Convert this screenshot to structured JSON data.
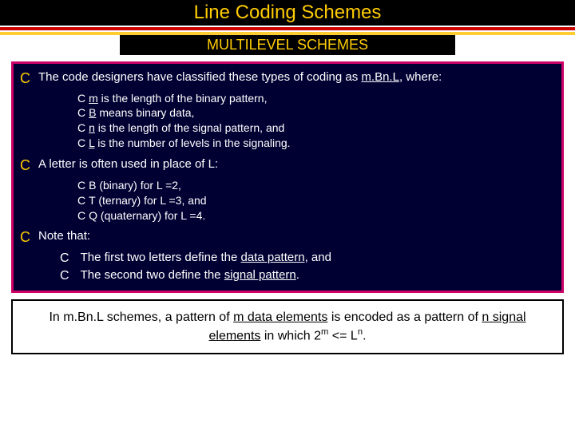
{
  "title": "Line Coding Schemes",
  "subtitle": "MULTILEVEL SCHEMES",
  "p1": {
    "prefix": "The code designers have classified these types of coding as ",
    "term": "m.Bn.L",
    "suffix": ", where:"
  },
  "p1_sub": {
    "a_pre": "m",
    "a_post": " is the length of the binary pattern,",
    "b_pre": "B",
    "b_post": " means binary data,",
    "c_pre": "n",
    "c_post": " is the length of the signal pattern, and",
    "d_pre": "L",
    "d_post": " is the number of levels in the signaling."
  },
  "p2": "A letter is often used in place of L:",
  "p2_sub": {
    "a": "B (binary) for L =2,",
    "b": "T (ternary) for L =3, and",
    "c": "Q (quaternary) for L =4."
  },
  "p3": "Note that:",
  "p3_sub": {
    "a_pre": "The first two letters define the ",
    "a_und": "data pattern",
    "a_post": ", and",
    "b_pre": "The second two define the ",
    "b_und": "signal pattern",
    "b_post": "."
  },
  "note": {
    "pre": "In m.Bn.L schemes, a pattern of ",
    "u1": "m data elements",
    "mid": " is encoded as a pattern of ",
    "u2": "n signal elements",
    "post1": " in which ",
    "f_base1": "2",
    "f_sup1": "m",
    "f_op": " <= L",
    "f_sup2": "n",
    "post2": "."
  }
}
